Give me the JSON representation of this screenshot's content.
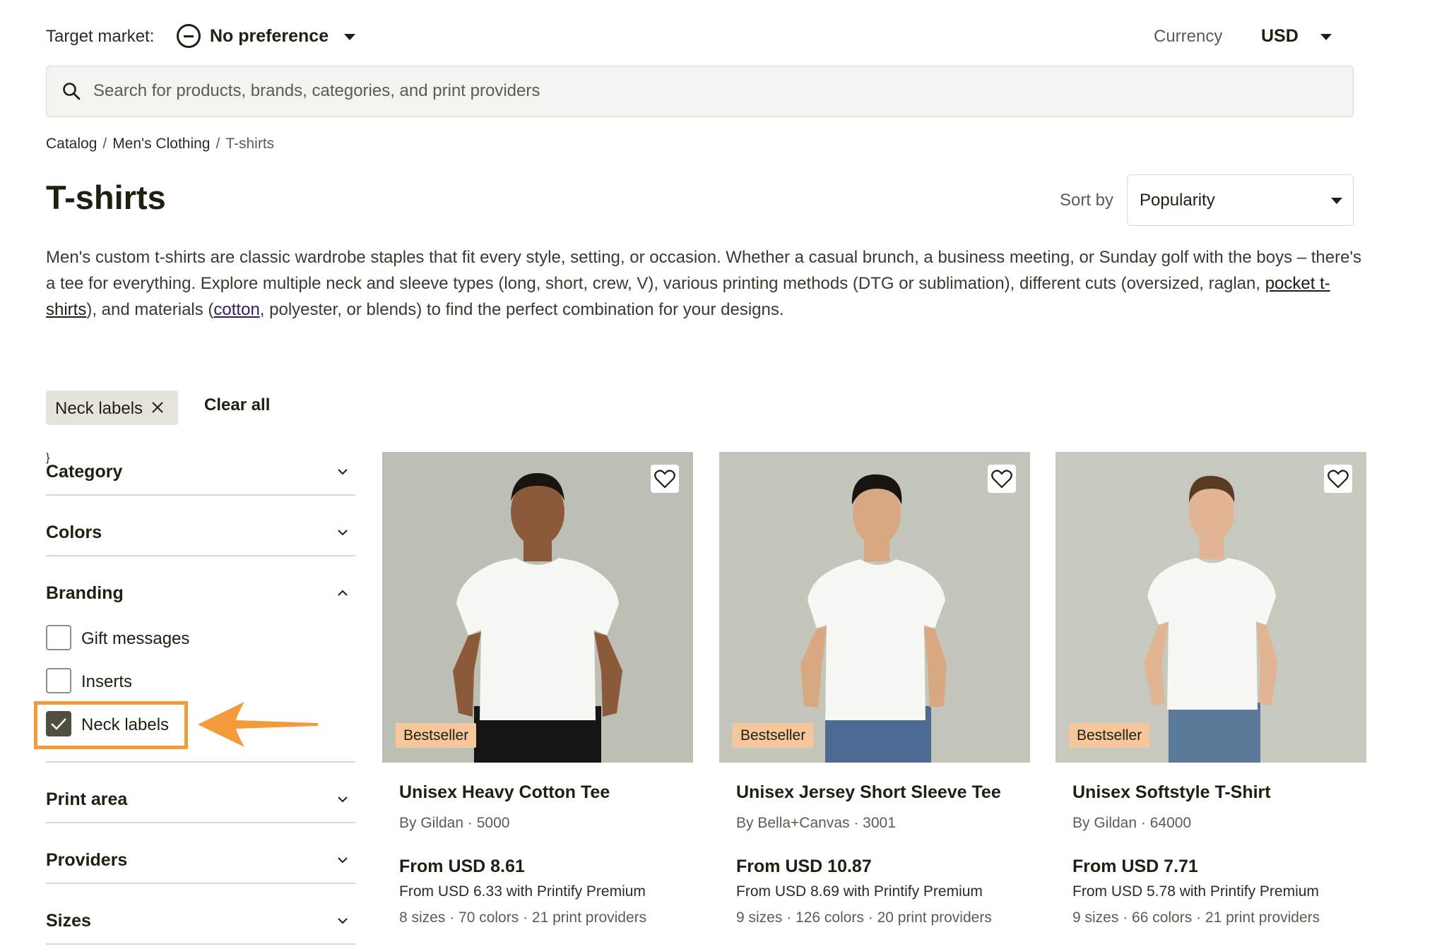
{
  "header": {
    "target_market_label": "Target market:",
    "target_market_value": "No preference",
    "currency_label": "Currency",
    "currency_value": "USD"
  },
  "search": {
    "placeholder": "Search for products, brands, categories, and print providers"
  },
  "breadcrumb": [
    "Catalog",
    "Men's Clothing",
    "T-shirts"
  ],
  "page": {
    "title": "T-shirts",
    "sort_label": "Sort by",
    "sort_value": "Popularity",
    "description_part1": "Men's custom t-shirts are classic wardrobe staples that fit every style, setting, or occasion. Whether a casual brunch, a business meeting, or Sunday golf with the boys – there's a tee for everything. Explore multiple neck and sleeve types (long, short, crew, V), various printing methods (DTG or sublimation), different cuts (oversized, raglan, ",
    "description_link1": "pocket t-shirts",
    "description_part2": "), and materials (",
    "description_link2": "cotton",
    "description_part3": ", polyester, or blends) to find the perfect combination for your designs."
  },
  "active_filters": {
    "chips": [
      "Neck labels"
    ],
    "clear_all_label": "Clear all"
  },
  "sidebar": {
    "sections": [
      {
        "title": "Category",
        "expanded": false
      },
      {
        "title": "Colors",
        "expanded": false
      },
      {
        "title": "Branding",
        "expanded": true,
        "options": [
          {
            "label": "Gift messages",
            "checked": false
          },
          {
            "label": "Inserts",
            "checked": false
          },
          {
            "label": "Neck labels",
            "checked": true
          }
        ]
      },
      {
        "title": "Print area",
        "expanded": false
      },
      {
        "title": "Providers",
        "expanded": false
      },
      {
        "title": "Sizes",
        "expanded": false
      }
    ]
  },
  "products": [
    {
      "badge": "Bestseller",
      "name": "Unisex Heavy Cotton Tee",
      "brand": "By Gildan · 5000",
      "price": "From USD 8.61",
      "premium": "From USD 6.33 with Printify Premium",
      "meta": "8 sizes · 70 colors · 21 print providers"
    },
    {
      "badge": "Bestseller",
      "name": "Unisex Jersey Short Sleeve Tee",
      "brand": "By Bella+Canvas · 3001",
      "price": "From USD 10.87",
      "premium": "From USD 8.69 with Printify Premium",
      "meta": "9 sizes · 126 colors · 20 print providers"
    },
    {
      "badge": "Bestseller",
      "name": "Unisex Softstyle T-Shirt",
      "brand": "By Gildan · 64000",
      "price": "From USD 7.71",
      "premium": "From USD 5.78 with Printify Premium",
      "meta": "9 sizes · 66 colors · 21 print providers"
    }
  ],
  "colors": {
    "text_dark": "#1f2012",
    "accent_highlight": "#f39a3a",
    "badge_bg": "#f6c79a",
    "chip_bg": "#e4e4dd",
    "checkbox_checked": "#4e4f3f"
  },
  "icons": [
    "minus-circle-icon",
    "chevron-down-icon",
    "search-icon",
    "close-icon",
    "chevron-up-icon",
    "checkmark-icon",
    "heart-icon",
    "arrow-left-icon"
  ]
}
